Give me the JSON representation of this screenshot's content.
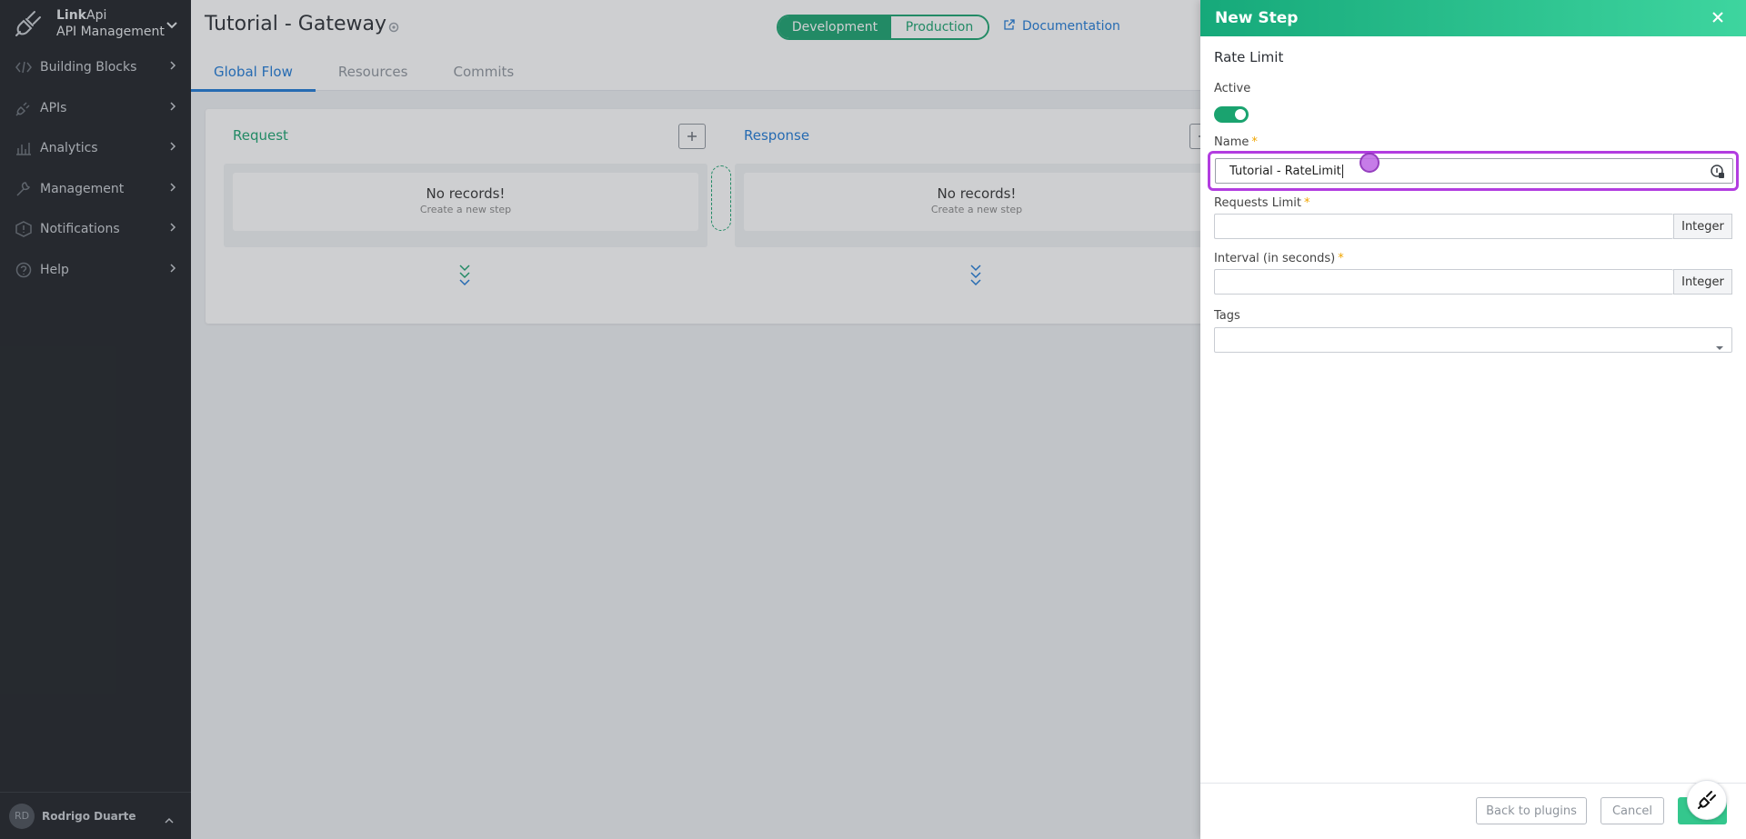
{
  "sidebar": {
    "brand_bold": "Link",
    "brand_rest": "Api",
    "brand_sub": "API Management",
    "items": [
      {
        "label": "Building Blocks",
        "icon": "code-icon"
      },
      {
        "label": "APIs",
        "icon": "plug-icon"
      },
      {
        "label": "Analytics",
        "icon": "bar-chart-icon"
      },
      {
        "label": "Management",
        "icon": "wrench-icon"
      },
      {
        "label": "Notifications",
        "icon": "warning-icon"
      },
      {
        "label": "Help",
        "icon": "question-icon"
      }
    ],
    "user": {
      "initials": "RD",
      "name": "Rodrigo Duarte"
    }
  },
  "header": {
    "title": "Tutorial - Gateway",
    "env": {
      "development": "Development",
      "production": "Production"
    },
    "documentation": "Documentation",
    "tabs": [
      "Global Flow",
      "Resources",
      "Commits"
    ]
  },
  "flow": {
    "request": {
      "title": "Request",
      "empty_title": "No records!",
      "empty_sub": "Create a new step"
    },
    "response": {
      "title": "Response",
      "empty_title": "No records!",
      "empty_sub": "Create a new step"
    }
  },
  "drawer": {
    "title": "New Step",
    "plugin": "Rate Limit",
    "active_label": "Active",
    "active": true,
    "name_label": "Name",
    "name_value": "Tutorial - RateLimit",
    "requests_limit_label": "Requests Limit",
    "requests_limit_addon": "Integer",
    "interval_label": "Interval (in seconds)",
    "interval_addon": "Integer",
    "tags_label": "Tags",
    "footer": {
      "back": "Back to plugins",
      "cancel": "Cancel"
    }
  },
  "colors": {
    "accent_green": "#1aa36f",
    "link_blue": "#1f7ad6",
    "focus_purple": "#b23de0"
  }
}
